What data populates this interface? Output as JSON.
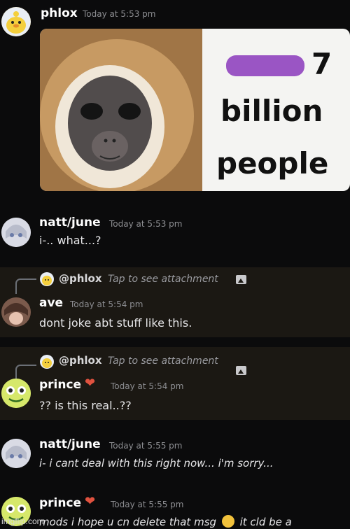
{
  "messages": [
    {
      "user": "phlox",
      "time": "Today at 5:53 pm"
    },
    {
      "user": "natt/june",
      "time": "Today at 5:53 pm",
      "text": "i-.. what...?"
    },
    {
      "reply_user": "@phlox",
      "reply_text": "Tap to see attachment",
      "user": "ave",
      "time": "Today at 5:54 pm",
      "text": "dont joke abt stuff like this."
    },
    {
      "reply_user": "@phlox",
      "reply_text": "Tap to see attachment",
      "user": "prince",
      "time": "Today at 5:54 pm",
      "text": "?? is this real..??"
    },
    {
      "user": "natt/june",
      "time": "Today at 5:55 pm",
      "text": "i- i cant deal with this right now... i'm sorry..."
    },
    {
      "user": "prince",
      "time": "Today at 5:55 pm",
      "text_a": "mods i hope u cn delete that msg",
      "text_b": "it cld be a"
    }
  ],
  "meme": {
    "line1_visible": "7",
    "line2": "billion",
    "line3": "people",
    "redaction_color": "#9a55c4"
  },
  "watermark": "imgflip.com",
  "colors": {
    "background": "#0b0b0c",
    "reply_band": "#1b1813",
    "username": "#ffffff",
    "timestamp": "#8d8e92",
    "heart": "#e0523f"
  }
}
